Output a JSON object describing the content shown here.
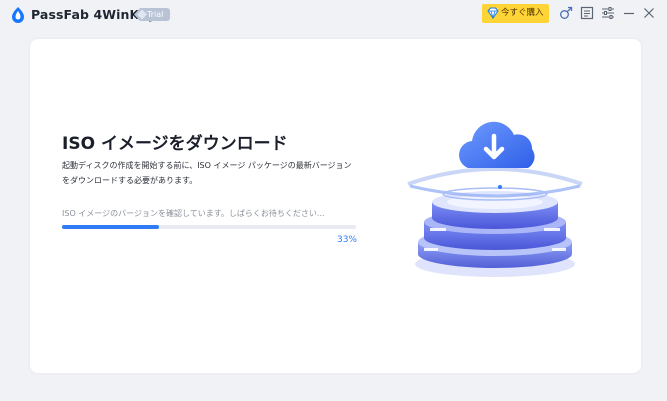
{
  "app": {
    "title": "PassFab 4WinKey",
    "trial_label": "Trial",
    "buy_label": "今すぐ購入"
  },
  "titlebar_icons": [
    "male-icon",
    "register-icon",
    "settings-icon",
    "minimize-icon",
    "close-icon"
  ],
  "main": {
    "heading": "ISO イメージをダウンロード",
    "description_line1": "起動ディスクの作成を開始する前に、ISO イメージ パッケージの最新バージョン",
    "description_line2": "をダウンロードする必要があります。",
    "status_text": "ISO イメージのバージョンを確認しています。しばらくお待ちください...",
    "progress": 0.33,
    "progress_label": "33%"
  },
  "colors": {
    "accent": "#2f7cf5",
    "buy_button": "#ffd436",
    "window_bg": "#f1f2f6"
  },
  "illustration": "cloud-download-server-icon"
}
